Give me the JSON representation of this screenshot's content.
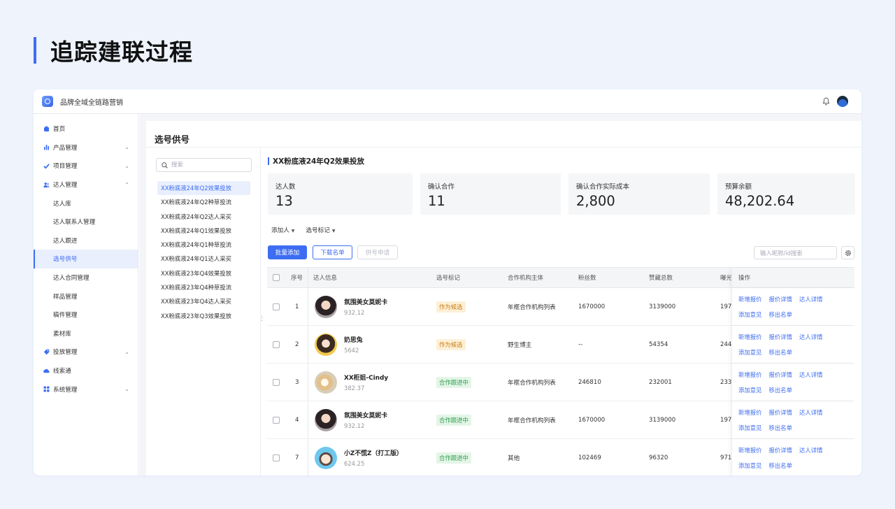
{
  "slide": {
    "title": "追踪建联过程"
  },
  "app": {
    "name": "品牌全域全链路营销"
  },
  "sidebar": {
    "items": [
      {
        "label": "首页",
        "icon": "home-icon"
      },
      {
        "label": "产品管理",
        "icon": "chart-icon",
        "chevron": "⌄"
      },
      {
        "label": "项目管理",
        "icon": "check-icon",
        "chevron": "⌄"
      },
      {
        "label": "达人管理",
        "icon": "users-icon",
        "chevron": "⌃"
      },
      {
        "label": "达人库"
      },
      {
        "label": "达人联系人管理"
      },
      {
        "label": "达人跟进"
      },
      {
        "label": "选号供号"
      },
      {
        "label": "达人合同管理"
      },
      {
        "label": "样品管理"
      },
      {
        "label": "稿件管理"
      },
      {
        "label": "素材库"
      },
      {
        "label": "投放管理",
        "icon": "tag-icon",
        "chevron": "⌄"
      },
      {
        "label": "线索通",
        "icon": "cloud-icon"
      },
      {
        "label": "系统管理",
        "icon": "grid-icon",
        "chevron": "⌄"
      }
    ]
  },
  "page": {
    "title": "选号供号"
  },
  "campaigns": {
    "search_placeholder": "搜索",
    "items": [
      "XX粉底液24年Q2效果投放",
      "XX粉底液24年Q2种草投流",
      "XX粉底液24年Q2达人采买",
      "XX粉底液24年Q1效果投放",
      "XX粉底液24年Q1种草投流",
      "XX粉底液24年Q1达人采买",
      "XX粉底液23年Q4效果投放",
      "XX粉底液23年Q4种草投流",
      "XX粉底液23年Q4达人采买",
      "XX粉底液23年Q3效果投放"
    ]
  },
  "main": {
    "campaign_title": "XX粉底液24年Q2效果投放",
    "stats": [
      {
        "label": "达人数",
        "value": "13"
      },
      {
        "label": "确认合作",
        "value": "11"
      },
      {
        "label": "确认合作实际成本",
        "value": "2,800"
      },
      {
        "label": "预算余额",
        "value": "48,202.64"
      }
    ],
    "filters": {
      "add_person": "添加人",
      "selection_tag": "选号标记",
      "caret": "▼"
    },
    "buttons": {
      "batch_add": "批量添加",
      "download_list": "下载名单",
      "supply_request": "供号申请"
    },
    "table_search_placeholder": "输入昵称/id搜索"
  },
  "table": {
    "headers": {
      "index": "序号",
      "info": "达人信息",
      "tag": "选号标记",
      "org": "合作机构主体",
      "fans": "粉丝数",
      "likes": "赞藏总数",
      "exposure": "曝光",
      "ops": "操作"
    },
    "rows": [
      {
        "index": "1",
        "name": "氛围美女莫妮卡",
        "score": "932.12",
        "tag": "作为候选",
        "tag_type": "orange",
        "org": "年框合作机构列表",
        "fans": "1670000",
        "likes": "3139000",
        "exposure": "197"
      },
      {
        "index": "2",
        "name": "奶思兔",
        "score": "5642",
        "tag": "作为候选",
        "tag_type": "orange",
        "org": "野生博主",
        "fans": "--",
        "likes": "54354",
        "exposure": "244"
      },
      {
        "index": "3",
        "name": "XX柜姐-Cindy",
        "score": "382.37",
        "tag": "合作跟进中",
        "tag_type": "green",
        "org": "年框合作机构列表",
        "fans": "246810",
        "likes": "232001",
        "exposure": "233"
      },
      {
        "index": "4",
        "name": "氛围美女莫妮卡",
        "score": "932.12",
        "tag": "合作跟进中",
        "tag_type": "green",
        "org": "年框合作机构列表",
        "fans": "1670000",
        "likes": "3139000",
        "exposure": "197"
      },
      {
        "index": "7",
        "name": "小Z不慌Z（打工版）",
        "score": "624.25",
        "tag": "合作跟进中",
        "tag_type": "green",
        "org": "其他",
        "fans": "102469",
        "likes": "96320",
        "exposure": "971"
      }
    ],
    "row_actions": [
      "新增报价",
      "报价详情",
      "达人详情",
      "添加意见",
      "移出名单"
    ]
  }
}
